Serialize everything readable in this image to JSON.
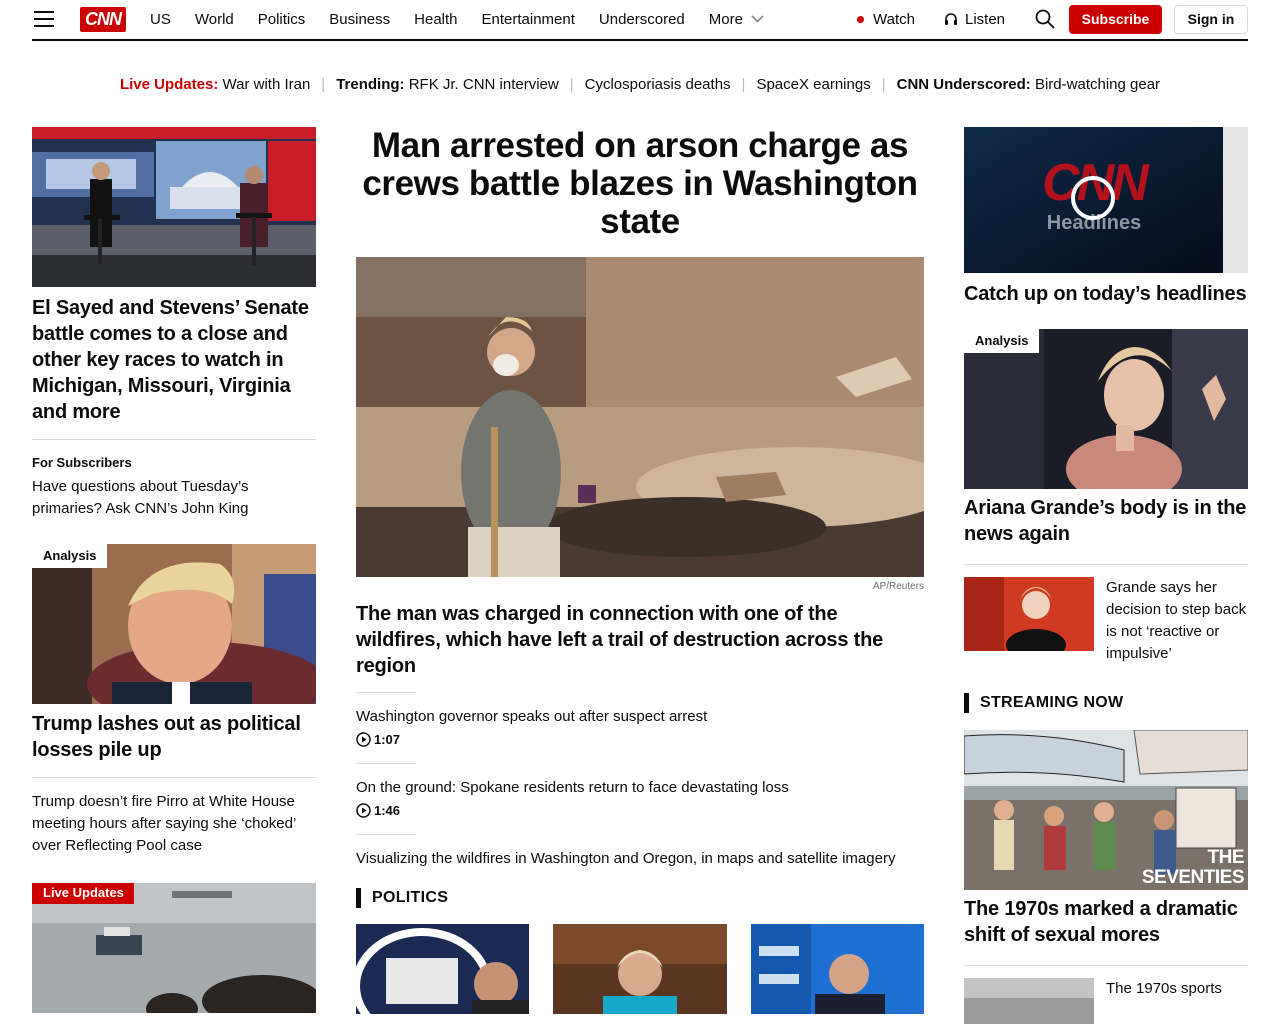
{
  "header": {
    "logo_text": "CNN",
    "nav": [
      "US",
      "World",
      "Politics",
      "Business",
      "Health",
      "Entertainment",
      "Underscored"
    ],
    "more_label": "More",
    "watch_label": "Watch",
    "listen_label": "Listen",
    "subscribe_label": "Subscribe",
    "signin_label": "Sign in"
  },
  "ticker": {
    "live_label": "Live Updates:",
    "live_text": "War with Iran",
    "trending_label": "Trending:",
    "trending_items": [
      "RFK Jr. CNN interview",
      "Cyclosporiasis deaths",
      "SpaceX earnings"
    ],
    "underscored_label": "CNN Underscored:",
    "underscored_text": "Bird-watching gear"
  },
  "left": {
    "story1_headline": "El Sayed and Stevens’ Senate battle comes to a close and other key races to watch in Michigan, Missouri, Virginia and more",
    "subscribers_label": "For Subscribers",
    "subscribers_text": "Have questions about Tuesday’s primaries? Ask CNN’s John King",
    "analysis_tag": "Analysis",
    "story2_headline": "Trump lashes out as political losses pile up",
    "story2_sub": "Trump doesn’t fire Pirro at White House meeting hours after saying she ‘choked’ over Reflecting Pool case",
    "live_tag": "Live Updates"
  },
  "center": {
    "headline": "Man arrested on arson charge as crews battle blazes in Washington state",
    "credit": "AP/Reuters",
    "subhead": "The man was charged in connection with one of the wildfires, which have left a trail of destruction across the region",
    "links": [
      {
        "text": "Washington governor speaks out after suspect arrest",
        "duration": "1:07"
      },
      {
        "text": "On the ground: Spokane residents return to face devastating loss",
        "duration": "1:46"
      },
      {
        "text": "Visualizing the wildfires in Washington and Oregon, in maps and satellite imagery",
        "duration": ""
      }
    ],
    "politics_label": "POLITICS"
  },
  "right": {
    "video_logo": "CNN",
    "video_sub": "Headlines",
    "video_headline": "Catch up on today’s headlines",
    "analysis_tag": "Analysis",
    "story_headline": "Ariana Grande’s body is in the news again",
    "small_story": "Grande says her decision to step back is not ‘reactive or impulsive’",
    "streaming_label": "STREAMING NOW",
    "seventies_overlay": "THE SEVENTIES",
    "stream_headline": "The 1970s marked a dramatic shift of sexual mores",
    "stream_small": "The 1970s sports"
  }
}
